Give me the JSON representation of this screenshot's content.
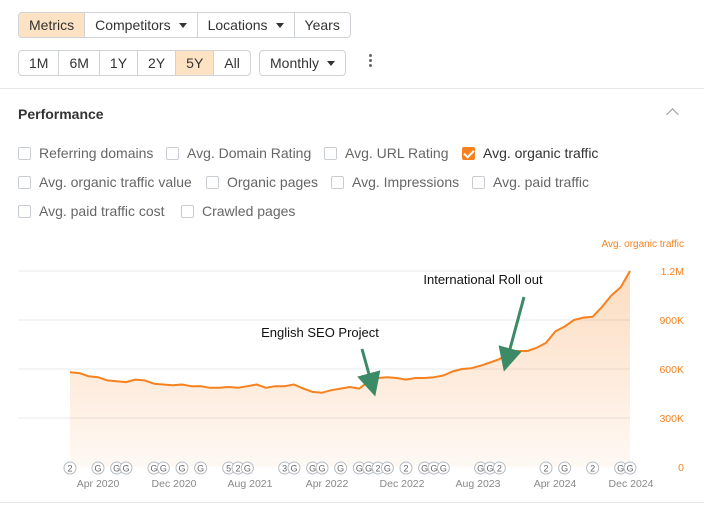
{
  "tabs": [
    {
      "label": "Metrics",
      "active": true,
      "dropdown": false
    },
    {
      "label": "Competitors",
      "active": false,
      "dropdown": true
    },
    {
      "label": "Locations",
      "active": false,
      "dropdown": true
    },
    {
      "label": "Years",
      "active": false,
      "dropdown": false
    }
  ],
  "ranges": [
    {
      "label": "1M",
      "active": false
    },
    {
      "label": "6M",
      "active": false
    },
    {
      "label": "1Y",
      "active": false
    },
    {
      "label": "2Y",
      "active": false
    },
    {
      "label": "5Y",
      "active": true
    },
    {
      "label": "All",
      "active": false
    }
  ],
  "interval": {
    "label": "Monthly"
  },
  "panel": {
    "title": "Performance"
  },
  "metrics": [
    {
      "label": "Referring domains",
      "checked": false
    },
    {
      "label": "Avg. Domain Rating",
      "checked": false
    },
    {
      "label": "Avg. URL Rating",
      "checked": false
    },
    {
      "label": "Avg. organic traffic",
      "checked": true
    },
    {
      "label": "Avg. organic traffic value",
      "checked": false
    },
    {
      "label": "Organic pages",
      "checked": false
    },
    {
      "label": "Avg. Impressions",
      "checked": false
    },
    {
      "label": "Avg. paid traffic",
      "checked": false
    },
    {
      "label": "Avg. paid traffic cost",
      "checked": false
    },
    {
      "label": "Crawled pages",
      "checked": false
    }
  ],
  "colors": {
    "accent": "#f5821f",
    "active_bg": "#fde3c4",
    "arrow": "#3d8b66"
  },
  "chart_data": {
    "type": "area",
    "series_label": "Avg. organic traffic",
    "y_ticks": [
      "1.2M",
      "900K",
      "600K",
      "300K",
      "0"
    ],
    "ylim": [
      0,
      1200000
    ],
    "x_ticks": [
      "Apr 2020",
      "Dec 2020",
      "Aug 2021",
      "Apr 2022",
      "Dec 2022",
      "Aug 2023",
      "Apr 2024",
      "Dec 2024"
    ],
    "x": [
      "2020-01",
      "2020-02",
      "2020-03",
      "2020-04",
      "2020-05",
      "2020-06",
      "2020-07",
      "2020-08",
      "2020-09",
      "2020-10",
      "2020-11",
      "2020-12",
      "2021-01",
      "2021-02",
      "2021-03",
      "2021-04",
      "2021-05",
      "2021-06",
      "2021-07",
      "2021-08",
      "2021-09",
      "2021-10",
      "2021-11",
      "2021-12",
      "2022-01",
      "2022-02",
      "2022-03",
      "2022-04",
      "2022-05",
      "2022-06",
      "2022-07",
      "2022-08",
      "2022-09",
      "2022-10",
      "2022-11",
      "2022-12",
      "2023-01",
      "2023-02",
      "2023-03",
      "2023-04",
      "2023-05",
      "2023-06",
      "2023-07",
      "2023-08",
      "2023-09",
      "2023-10",
      "2023-11",
      "2023-12",
      "2024-01",
      "2024-02",
      "2024-03",
      "2024-04",
      "2024-05",
      "2024-06",
      "2024-07",
      "2024-08",
      "2024-09",
      "2024-10",
      "2024-11",
      "2024-12",
      "2025-01"
    ],
    "values": [
      580000,
      575000,
      555000,
      550000,
      530000,
      525000,
      520000,
      535000,
      530000,
      510000,
      505000,
      500000,
      505000,
      495000,
      495000,
      485000,
      485000,
      490000,
      485000,
      495000,
      505000,
      485000,
      495000,
      495000,
      505000,
      480000,
      460000,
      455000,
      470000,
      480000,
      490000,
      480000,
      525000,
      545000,
      550000,
      545000,
      535000,
      545000,
      545000,
      550000,
      560000,
      585000,
      600000,
      605000,
      620000,
      640000,
      660000,
      700000,
      710000,
      710000,
      730000,
      760000,
      830000,
      860000,
      900000,
      915000,
      920000,
      980000,
      1050000,
      1100000,
      1200000
    ],
    "annotations": [
      {
        "label": "English SEO Project",
        "x": "2022-10"
      },
      {
        "label": "International Roll out",
        "x": "2023-10"
      }
    ],
    "markers": [
      {
        "label": "2",
        "x": "2020-01"
      },
      {
        "label": "G",
        "x": "2020-04"
      },
      {
        "label": "G",
        "x": "2020-06"
      },
      {
        "label": "G",
        "x": "2020-07"
      },
      {
        "label": "G",
        "x": "2020-10"
      },
      {
        "label": "G",
        "x": "2020-11"
      },
      {
        "label": "G",
        "x": "2021-01"
      },
      {
        "label": "G",
        "x": "2021-03"
      },
      {
        "label": "5",
        "x": "2021-06"
      },
      {
        "label": "2",
        "x": "2021-07"
      },
      {
        "label": "G",
        "x": "2021-08"
      },
      {
        "label": "3",
        "x": "2021-12"
      },
      {
        "label": "G",
        "x": "2022-01"
      },
      {
        "label": "G",
        "x": "2022-03"
      },
      {
        "label": "G",
        "x": "2022-04"
      },
      {
        "label": "G",
        "x": "2022-06"
      },
      {
        "label": "G",
        "x": "2022-08"
      },
      {
        "label": "G",
        "x": "2022-09"
      },
      {
        "label": "2",
        "x": "2022-10"
      },
      {
        "label": "G",
        "x": "2022-11"
      },
      {
        "label": "2",
        "x": "2023-01"
      },
      {
        "label": "G",
        "x": "2023-03"
      },
      {
        "label": "G",
        "x": "2023-04"
      },
      {
        "label": "G",
        "x": "2023-05"
      },
      {
        "label": "G",
        "x": "2023-09"
      },
      {
        "label": "G",
        "x": "2023-10"
      },
      {
        "label": "2",
        "x": "2023-11"
      },
      {
        "label": "2",
        "x": "2024-04"
      },
      {
        "label": "G",
        "x": "2024-06"
      },
      {
        "label": "2",
        "x": "2024-09"
      },
      {
        "label": "G",
        "x": "2024-12"
      },
      {
        "label": "G",
        "x": "2025-01"
      }
    ]
  }
}
